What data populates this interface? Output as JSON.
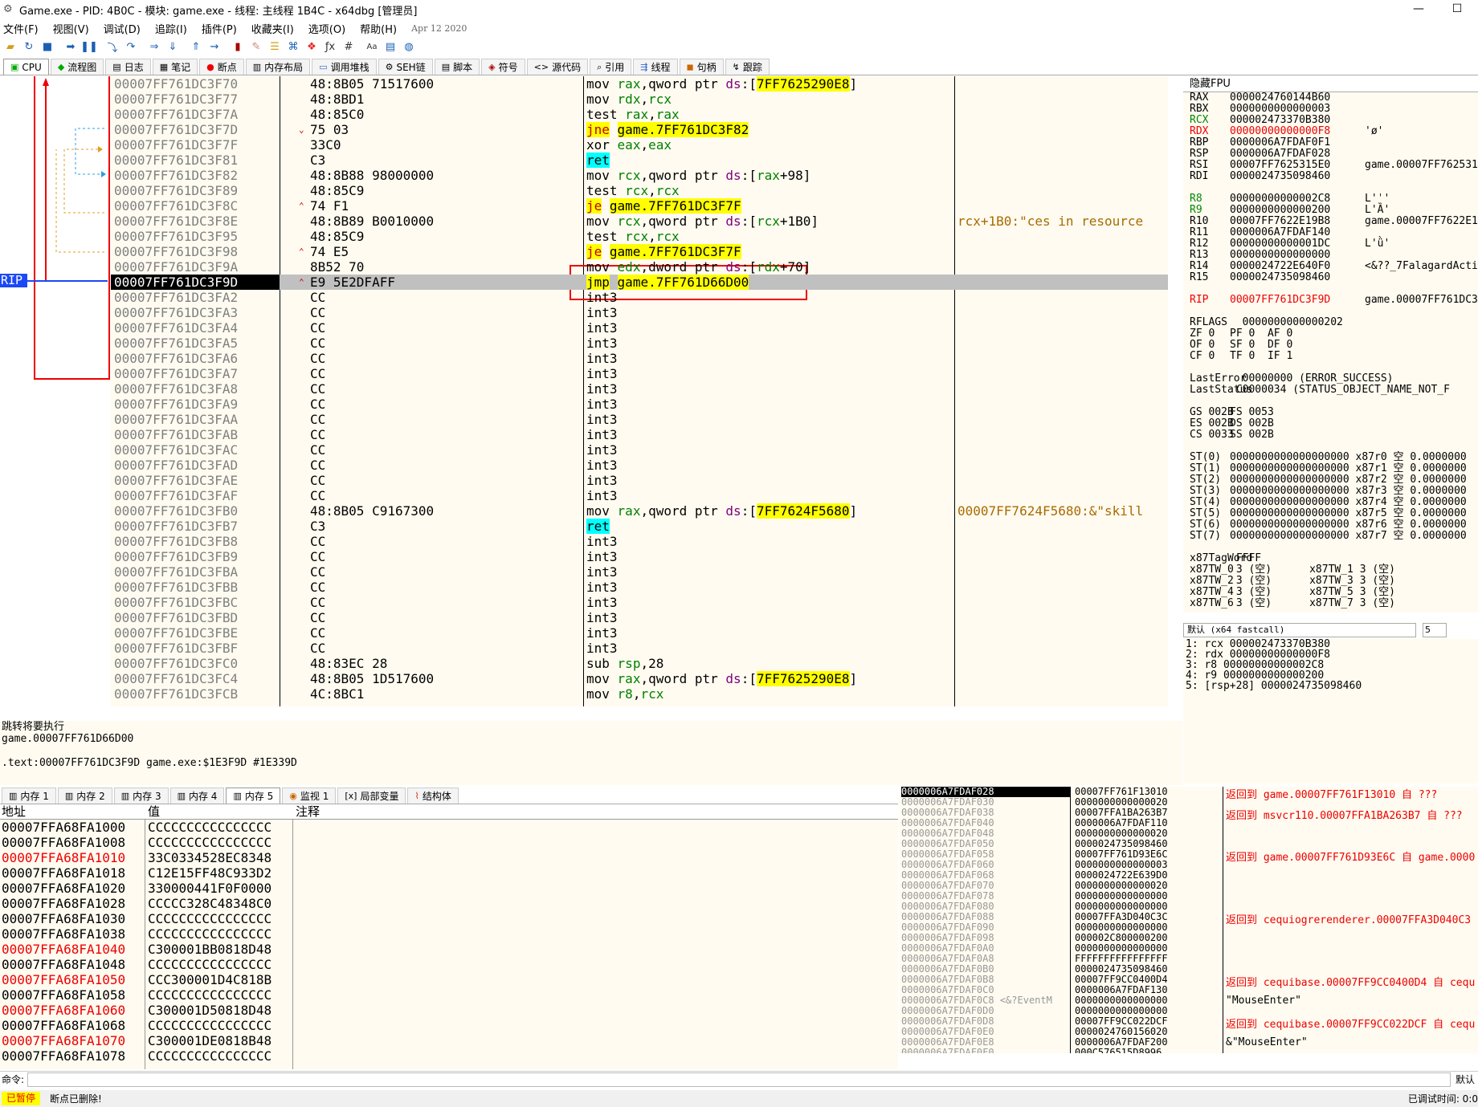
{
  "window": {
    "title": "Game.exe - PID: 4B0C - 模块: game.exe - 线程: 主线程 1B4C - x64dbg [管理员]",
    "minimize": "—",
    "maximize": "☐"
  },
  "menu": {
    "items": [
      "文件(F)",
      "视图(V)",
      "调试(D)",
      "追踪(I)",
      "插件(P)",
      "收藏夹(I)",
      "选项(O)",
      "帮助(H)"
    ],
    "date": "Apr 12 2020"
  },
  "tabs": [
    {
      "label": "CPU",
      "icon": "cpu-icon",
      "active": true
    },
    {
      "label": "流程图",
      "icon": "graph-icon"
    },
    {
      "label": "日志",
      "icon": "log-icon"
    },
    {
      "label": "笔记",
      "icon": "notes-icon"
    },
    {
      "label": "断点",
      "icon": "breakpoint-icon"
    },
    {
      "label": "内存布局",
      "icon": "memory-map-icon"
    },
    {
      "label": "调用堆栈",
      "icon": "call-stack-icon"
    },
    {
      "label": "SEH链",
      "icon": "seh-icon"
    },
    {
      "label": "脚本",
      "icon": "script-icon"
    },
    {
      "label": "符号",
      "icon": "symbol-icon"
    },
    {
      "label": "源代码",
      "icon": "source-icon"
    },
    {
      "label": "引用",
      "icon": "references-icon"
    },
    {
      "label": "线程",
      "icon": "threads-icon"
    },
    {
      "label": "句柄",
      "icon": "handles-icon"
    },
    {
      "label": "跟踪",
      "icon": "trace-icon"
    }
  ],
  "cpu": {
    "rip_label": "RIP",
    "rows": [
      {
        "addr": "00007FF761DC3F70",
        "bytes": "48:8B05 71517600",
        "ins": "mov rax,qword ptr ds:[7FF7625290E8]",
        "kind": "mem"
      },
      {
        "addr": "00007FF761DC3F77",
        "bytes": "48:8BD1",
        "ins": "mov rdx,rcx"
      },
      {
        "addr": "00007FF761DC3F7A",
        "bytes": "48:85C0",
        "ins": "test rax,rax"
      },
      {
        "addr": "00007FF761DC3F7D",
        "bytes": "75 03",
        "ins": "jne game.7FF761DC3F82",
        "kind": "jcc",
        "mark": "⌄"
      },
      {
        "addr": "00007FF761DC3F7F",
        "bytes": "33C0",
        "ins": "xor eax,eax"
      },
      {
        "addr": "00007FF761DC3F81",
        "bytes": "C3",
        "ins": "ret",
        "kind": "ret"
      },
      {
        "addr": "00007FF761DC3F82",
        "bytes": "48:8B88 98000000",
        "ins": "mov rcx,qword ptr ds:[rax+98]"
      },
      {
        "addr": "00007FF761DC3F89",
        "bytes": "48:85C9",
        "ins": "test rcx,rcx"
      },
      {
        "addr": "00007FF761DC3F8C",
        "bytes": "74 F1",
        "ins": "je game.7FF761DC3F7F",
        "kind": "jcc",
        "mark": "⌃"
      },
      {
        "addr": "00007FF761DC3F8E",
        "bytes": "48:8B89 B0010000",
        "ins": "mov rcx,qword ptr ds:[rcx+1B0]",
        "cmt": "rcx+1B0:\"ces in resource"
      },
      {
        "addr": "00007FF761DC3F95",
        "bytes": "48:85C9",
        "ins": "test rcx,rcx"
      },
      {
        "addr": "00007FF761DC3F98",
        "bytes": "74 E5",
        "ins": "je game.7FF761DC3F7F",
        "kind": "jcc",
        "mark": "⌃"
      },
      {
        "addr": "00007FF761DC3F9A",
        "bytes": "8B52 70",
        "ins": "mov edx,dword ptr ds:[rdx+70]"
      },
      {
        "addr": "00007FF761DC3F9D",
        "bytes": "E9 5E2DFAFF",
        "ins": "jmp game.7FF761D66D00",
        "kind": "jmp",
        "current": true,
        "mark": "⌃"
      },
      {
        "addr": "00007FF761DC3FA2",
        "bytes": "CC",
        "ins": "int3"
      },
      {
        "addr": "00007FF761DC3FA3",
        "bytes": "CC",
        "ins": "int3"
      },
      {
        "addr": "00007FF761DC3FA4",
        "bytes": "CC",
        "ins": "int3"
      },
      {
        "addr": "00007FF761DC3FA5",
        "bytes": "CC",
        "ins": "int3"
      },
      {
        "addr": "00007FF761DC3FA6",
        "bytes": "CC",
        "ins": "int3"
      },
      {
        "addr": "00007FF761DC3FA7",
        "bytes": "CC",
        "ins": "int3"
      },
      {
        "addr": "00007FF761DC3FA8",
        "bytes": "CC",
        "ins": "int3"
      },
      {
        "addr": "00007FF761DC3FA9",
        "bytes": "CC",
        "ins": "int3"
      },
      {
        "addr": "00007FF761DC3FAA",
        "bytes": "CC",
        "ins": "int3"
      },
      {
        "addr": "00007FF761DC3FAB",
        "bytes": "CC",
        "ins": "int3"
      },
      {
        "addr": "00007FF761DC3FAC",
        "bytes": "CC",
        "ins": "int3"
      },
      {
        "addr": "00007FF761DC3FAD",
        "bytes": "CC",
        "ins": "int3"
      },
      {
        "addr": "00007FF761DC3FAE",
        "bytes": "CC",
        "ins": "int3"
      },
      {
        "addr": "00007FF761DC3FAF",
        "bytes": "CC",
        "ins": "int3"
      },
      {
        "addr": "00007FF761DC3FB0",
        "bytes": "48:8B05 C9167300",
        "ins": "mov rax,qword ptr ds:[7FF7624F5680]",
        "kind": "mem",
        "cmt": "00007FF7624F5680:&\"skill"
      },
      {
        "addr": "00007FF761DC3FB7",
        "bytes": "C3",
        "ins": "ret",
        "kind": "ret"
      },
      {
        "addr": "00007FF761DC3FB8",
        "bytes": "CC",
        "ins": "int3"
      },
      {
        "addr": "00007FF761DC3FB9",
        "bytes": "CC",
        "ins": "int3"
      },
      {
        "addr": "00007FF761DC3FBA",
        "bytes": "CC",
        "ins": "int3"
      },
      {
        "addr": "00007FF761DC3FBB",
        "bytes": "CC",
        "ins": "int3"
      },
      {
        "addr": "00007FF761DC3FBC",
        "bytes": "CC",
        "ins": "int3"
      },
      {
        "addr": "00007FF761DC3FBD",
        "bytes": "CC",
        "ins": "int3"
      },
      {
        "addr": "00007FF761DC3FBE",
        "bytes": "CC",
        "ins": "int3"
      },
      {
        "addr": "00007FF761DC3FBF",
        "bytes": "CC",
        "ins": "int3"
      },
      {
        "addr": "00007FF761DC3FC0",
        "bytes": "48:83EC 28",
        "ins": "sub rsp,28"
      },
      {
        "addr": "00007FF761DC3FC4",
        "bytes": "48:8B05 1D517600",
        "ins": "mov rax,qword ptr ds:[7FF7625290E8]",
        "kind": "mem"
      },
      {
        "addr": "00007FF761DC3FCB",
        "bytes": "4C:8BC1",
        "ins": "mov r8,rcx"
      }
    ]
  },
  "info": {
    "lines": [
      "跳转将要执行",
      "game.00007FF761D66D00",
      "",
      ".text:00007FF761DC3F9D game.exe:$1E3F9D #1E339D"
    ]
  },
  "registers": {
    "header": "隐藏FPU",
    "lines": [
      {
        "n": "RAX",
        "v": "0000024760144B60",
        "c": ""
      },
      {
        "n": "RBX",
        "v": "0000000000000003",
        "c": ""
      },
      {
        "n": "RCX",
        "v": "000002473370B380",
        "c": "",
        "green": true
      },
      {
        "n": "RDX",
        "v": "00000000000000F8",
        "c": "'ø'",
        "changed": true
      },
      {
        "n": "RBP",
        "v": "0000006A7FDAF0F1",
        "c": ""
      },
      {
        "n": "RSP",
        "v": "0000006A7FDAF028",
        "c": ""
      },
      {
        "n": "RSI",
        "v": "00007FF7625315E0",
        "c": "game.00007FF762531"
      },
      {
        "n": "RDI",
        "v": "0000024735098460",
        "c": ""
      },
      {
        "n": "",
        "v": "",
        "c": ""
      },
      {
        "n": "R8",
        "v": "00000000000002C8",
        "c": "L'ˈ'",
        "green": true
      },
      {
        "n": "R9",
        "v": "0000000000000200",
        "c": "L'Ȁ'",
        "green": true
      },
      {
        "n": "R10",
        "v": "00007FF7622E19B8",
        "c": "game.00007FF7622E1"
      },
      {
        "n": "R11",
        "v": "0000006A7FDAF140",
        "c": ""
      },
      {
        "n": "R12",
        "v": "00000000000001DC",
        "c": "L'ǜ'"
      },
      {
        "n": "R13",
        "v": "0000000000000000",
        "c": ""
      },
      {
        "n": "R14",
        "v": "0000024722E640F0",
        "c": "<&??_7FalagardActi"
      },
      {
        "n": "R15",
        "v": "0000024735098460",
        "c": ""
      },
      {
        "n": "",
        "v": "",
        "c": ""
      },
      {
        "n": "RIP",
        "v": "00007FF761DC3F9D",
        "c": "game.00007FF761DC3",
        "changed": true
      },
      {
        "n": "",
        "v": "",
        "c": ""
      },
      {
        "n": "RFLAGS",
        "v": "  0000000000000202",
        "c": ""
      },
      {
        "n": "ZF 0",
        "v": "PF 0  AF 0",
        "c": ""
      },
      {
        "n": "OF 0",
        "v": "SF 0  DF 0",
        "c": ""
      },
      {
        "n": "CF 0",
        "v": "TF 0  IF 1",
        "c": ""
      },
      {
        "n": "",
        "v": "",
        "c": ""
      },
      {
        "n": "LastError",
        "v": "  00000000 (ERROR_SUCCESS)",
        "c": ""
      },
      {
        "n": "LastStatus",
        "v": " C0000034 (STATUS_OBJECT_NAME_NOT_F",
        "c": ""
      },
      {
        "n": "",
        "v": "",
        "c": ""
      },
      {
        "n": "GS 002B",
        "v": "FS 0053",
        "c": ""
      },
      {
        "n": "ES 002B",
        "v": "DS 002B",
        "c": ""
      },
      {
        "n": "CS 0033",
        "v": "SS 002B",
        "c": ""
      },
      {
        "n": "",
        "v": "",
        "c": ""
      },
      {
        "n": "ST(0)",
        "v": "0000000000000000000 x87r0 空 0.0000000",
        "c": ""
      },
      {
        "n": "ST(1)",
        "v": "0000000000000000000 x87r1 空 0.0000000",
        "c": ""
      },
      {
        "n": "ST(2)",
        "v": "0000000000000000000 x87r2 空 0.0000000",
        "c": ""
      },
      {
        "n": "ST(3)",
        "v": "0000000000000000000 x87r3 空 0.0000000",
        "c": ""
      },
      {
        "n": "ST(4)",
        "v": "0000000000000000000 x87r4 空 0.0000000",
        "c": ""
      },
      {
        "n": "ST(5)",
        "v": "0000000000000000000 x87r5 空 0.0000000",
        "c": ""
      },
      {
        "n": "ST(6)",
        "v": "0000000000000000000 x87r6 空 0.0000000",
        "c": ""
      },
      {
        "n": "ST(7)",
        "v": "0000000000000000000 x87r7 空 0.0000000",
        "c": ""
      },
      {
        "n": "",
        "v": "",
        "c": ""
      },
      {
        "n": "x87TagWord",
        "v": " FFFF",
        "c": ""
      },
      {
        "n": "x87TW_0",
        "v": " 3 (空)      x87TW_1 3 (空)",
        "c": ""
      },
      {
        "n": "x87TW_2",
        "v": " 3 (空)      x87TW_3 3 (空)",
        "c": ""
      },
      {
        "n": "x87TW_4",
        "v": " 3 (空)      x87TW_5 3 (空)",
        "c": ""
      },
      {
        "n": "x87TW_6",
        "v": " 3 (空)      x87TW_7 3 (空)",
        "c": ""
      }
    ]
  },
  "callconv": {
    "selected": "默认 (x64 fastcall)",
    "count": "5",
    "args": [
      "1: rcx 000002473370B380",
      "2: rdx 00000000000000F8",
      "3: r8 00000000000002C8",
      "4: r9 0000000000000200",
      "5: [rsp+28] 0000024735098460"
    ]
  },
  "memtabs": [
    {
      "label": "内存 1",
      "icon": "memory-icon"
    },
    {
      "label": "内存 2",
      "icon": "memory-icon"
    },
    {
      "label": "内存 3",
      "icon": "memory-icon"
    },
    {
      "label": "内存 4",
      "icon": "memory-icon"
    },
    {
      "label": "内存 5",
      "icon": "memory-icon",
      "active": true
    },
    {
      "label": "监视 1",
      "icon": "watch-icon"
    },
    {
      "label": "局部变量",
      "icon": "locals-icon"
    },
    {
      "label": "结构体",
      "icon": "struct-icon"
    }
  ],
  "memory": {
    "headers": {
      "addr": "地址",
      "value": "值",
      "comment": "注释"
    },
    "rows": [
      {
        "a": "00007FFA68FA1000",
        "v": "CCCCCCCCCCCCCCCC"
      },
      {
        "a": "00007FFA68FA1008",
        "v": "CCCCCCCCCCCCCCCC"
      },
      {
        "a": "00007FFA68FA1010",
        "v": "33C0334528EC8348",
        "red": true
      },
      {
        "a": "00007FFA68FA1018",
        "v": "C12E15FF48C933D2"
      },
      {
        "a": "00007FFA68FA1020",
        "v": "330000441F0F0000"
      },
      {
        "a": "00007FFA68FA1028",
        "v": "CCCCC328C48348C0"
      },
      {
        "a": "00007FFA68FA1030",
        "v": "CCCCCCCCCCCCCCCC"
      },
      {
        "a": "00007FFA68FA1038",
        "v": "CCCCCCCCCCCCCCCC"
      },
      {
        "a": "00007FFA68FA1040",
        "v": "C300001BB0818D48",
        "red": true
      },
      {
        "a": "00007FFA68FA1048",
        "v": "CCCCCCCCCCCCCCCC"
      },
      {
        "a": "00007FFA68FA1050",
        "v": "CCC300001D4C818B",
        "red": true
      },
      {
        "a": "00007FFA68FA1058",
        "v": "CCCCCCCCCCCCCCCC"
      },
      {
        "a": "00007FFA68FA1060",
        "v": "C300001D50818D48",
        "red": true
      },
      {
        "a": "00007FFA68FA1068",
        "v": "CCCCCCCCCCCCCCCC"
      },
      {
        "a": "00007FFA68FA1070",
        "v": "C300001DE0818B48",
        "red": true
      },
      {
        "a": "00007FFA68FA1078",
        "v": "CCCCCCCCCCCCCCCC"
      }
    ]
  },
  "stack": {
    "rows": [
      {
        "a": "0000006A7FDAF028",
        "v": "00007FF761F13010",
        "sel": true
      },
      {
        "a": "0000006A7FDAF030",
        "v": "0000000000000020"
      },
      {
        "a": "0000006A7FDAF038",
        "v": "00007FFA1BA263B7"
      },
      {
        "a": "0000006A7FDAF040",
        "v": "0000006A7FDAF110"
      },
      {
        "a": "0000006A7FDAF048",
        "v": "0000000000000020"
      },
      {
        "a": "0000006A7FDAF050",
        "v": "0000024735098460"
      },
      {
        "a": "0000006A7FDAF058",
        "v": "00007FF761D93E6C"
      },
      {
        "a": "0000006A7FDAF060",
        "v": "0000000000000003"
      },
      {
        "a": "0000006A7FDAF068",
        "v": "0000024722E639D0"
      },
      {
        "a": "0000006A7FDAF070",
        "v": "0000000000000020"
      },
      {
        "a": "0000006A7FDAF078",
        "v": "0000000000000000"
      },
      {
        "a": "0000006A7FDAF080",
        "v": "0000000000000000"
      },
      {
        "a": "0000006A7FDAF088",
        "v": "00007FFA3D040C3C"
      },
      {
        "a": "0000006A7FDAF090",
        "v": "0000000000000000"
      },
      {
        "a": "0000006A7FDAF098",
        "v": "000002C800000200"
      },
      {
        "a": "0000006A7FDAF0A0",
        "v": "0000000000000000"
      },
      {
        "a": "0000006A7FDAF0A8",
        "v": "FFFFFFFFFFFFFFFF"
      },
      {
        "a": "0000006A7FDAF0B0",
        "v": "0000024735098460"
      },
      {
        "a": "0000006A7FDAF0B8",
        "v": "00007FF9CC0400D4"
      },
      {
        "a": "0000006A7FDAF0C0",
        "v": "0000006A7FDAF130"
      },
      {
        "a": "0000006A7FDAF0C8 <&?EventM",
        "v": "0000000000000000"
      },
      {
        "a": "0000006A7FDAF0D0",
        "v": "0000000000000000"
      },
      {
        "a": "0000006A7FDAF0D8",
        "v": "00007FF9CC022DCF"
      },
      {
        "a": "0000006A7FDAF0E0",
        "v": "0000024760156020"
      },
      {
        "a": "0000006A7FDAF0E8",
        "v": "0000006A7FDAF200"
      },
      {
        "a": "0000006A7FDAF0F0",
        "v": "000C576515D8996"
      }
    ],
    "comments": [
      {
        "row": 0,
        "text": "返回到 game.00007FF761F13010 自 ???",
        "kind": "ret"
      },
      {
        "row": 2,
        "text": "返回到 msvcr110.00007FFA1BA263B7 自 ???",
        "kind": "ret"
      },
      {
        "row": 6,
        "text": "返回到 game.00007FF761D93E6C 自 game.0000",
        "kind": "ret"
      },
      {
        "row": 12,
        "text": "返回到 cequiogrerenderer.00007FFA3D040C3",
        "kind": "ret"
      },
      {
        "row": 18,
        "text": "返回到 cequibase.00007FF9CC0400D4 自 cequ",
        "kind": "ret"
      },
      {
        "row": 20,
        "text": "\"MouseEnter\"",
        "kind": "str"
      },
      {
        "row": 22,
        "text": "返回到 cequibase.00007FF9CC022DCF 自 cequ",
        "kind": "ret"
      },
      {
        "row": 24,
        "text": "&\"MouseEnter\"",
        "kind": "str"
      }
    ]
  },
  "cmd": {
    "label": "命令:",
    "default": "默认"
  },
  "status": {
    "paused": "已暂停",
    "message": "断点已删除!",
    "time": "已调试时间:  0:0"
  }
}
